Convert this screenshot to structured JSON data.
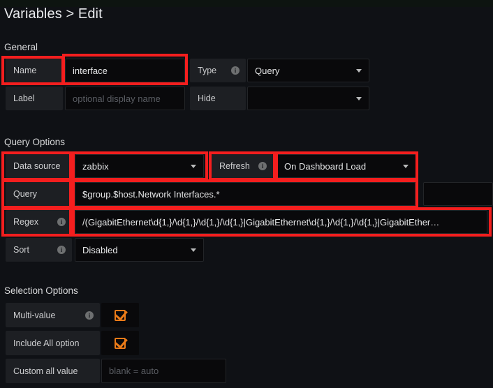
{
  "page": {
    "title": "Variables > Edit",
    "accent_red": "#f41e1e",
    "accent_orange": "#eb7b18",
    "background": "#0f1115"
  },
  "sections": {
    "general": {
      "heading": "General",
      "rows": {
        "name": {
          "label": "Name",
          "value": "interface"
        },
        "type": {
          "label": "Type",
          "info_icon": "info-icon",
          "value": "Query",
          "caret_icon": "chevron-down-icon"
        },
        "label": {
          "label": "Label",
          "value": "",
          "placeholder": "optional display name"
        },
        "hide": {
          "label": "Hide",
          "value": "",
          "caret_icon": "chevron-down-icon"
        }
      }
    },
    "query_options": {
      "heading": "Query Options",
      "rows": {
        "datasource": {
          "label": "Data source",
          "value": "zabbix",
          "caret_icon": "chevron-down-icon"
        },
        "refresh": {
          "label": "Refresh",
          "info_icon": "info-icon",
          "value": "On Dashboard Load",
          "caret_icon": "chevron-down-icon"
        },
        "query": {
          "label": "Query",
          "value": "$group.$host.Network Interfaces.*"
        },
        "regex": {
          "label": "Regex",
          "info_icon": "info-icon",
          "value": "/(GigabitEthernet\\d{1,}/\\d{1,}/\\d{1,}/\\d{1,}|GigabitEthernet\\d{1,}/\\d{1,}/\\d{1,}|GigabitEther…"
        },
        "sort": {
          "label": "Sort",
          "info_icon": "info-icon",
          "value": "Disabled",
          "caret_icon": "chevron-down-icon"
        }
      }
    },
    "selection_options": {
      "heading": "Selection Options",
      "rows": {
        "multi_value": {
          "label": "Multi-value",
          "info_icon": "info-icon",
          "checked": true,
          "check_icon": "checkbox-checked-icon"
        },
        "include_all": {
          "label": "Include All option",
          "checked": true,
          "check_icon": "checkbox-checked-icon"
        },
        "custom_all_value": {
          "label": "Custom all value",
          "value": "",
          "placeholder": "blank = auto"
        }
      }
    }
  }
}
